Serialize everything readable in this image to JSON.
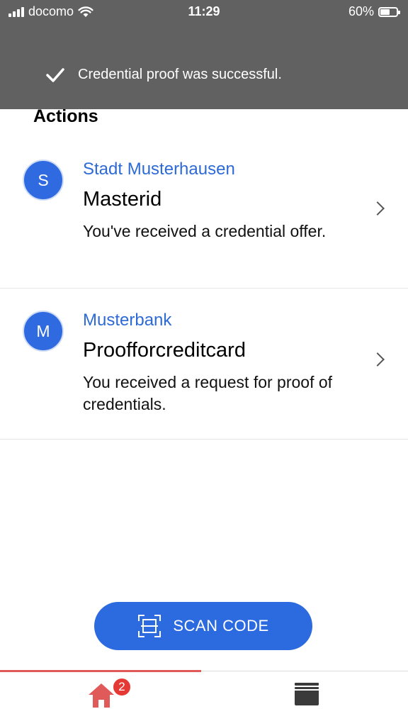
{
  "status_bar": {
    "carrier": "docomo",
    "time": "11:29",
    "battery": "60%",
    "battery_level": 0.6
  },
  "toast": {
    "message": "Credential proof was successful.",
    "icon": "checkmark-icon"
  },
  "actions": {
    "title": "Actions",
    "items": [
      {
        "avatar_letter": "S",
        "issuer": "Stadt Musterhausen",
        "credential": "Masterid",
        "description": "You've received a credential offer."
      },
      {
        "avatar_letter": "M",
        "issuer": "Musterbank",
        "credential": "Proofforcreditcard",
        "description": "You received a request for proof of credentials."
      }
    ]
  },
  "scan_button": {
    "label": "SCAN CODE",
    "icon": "scan-frame-icon"
  },
  "tab_bar": {
    "home_badge": "2",
    "tabs": [
      "home-icon",
      "wallet-icon"
    ],
    "colors": {
      "active": "#e05a5a",
      "inactive": "#3a3a3a"
    }
  },
  "colors": {
    "accent": "#2c6ae0",
    "issuer_text": "#2d6ad6",
    "banner": "#616161",
    "badge": "#e53935"
  }
}
